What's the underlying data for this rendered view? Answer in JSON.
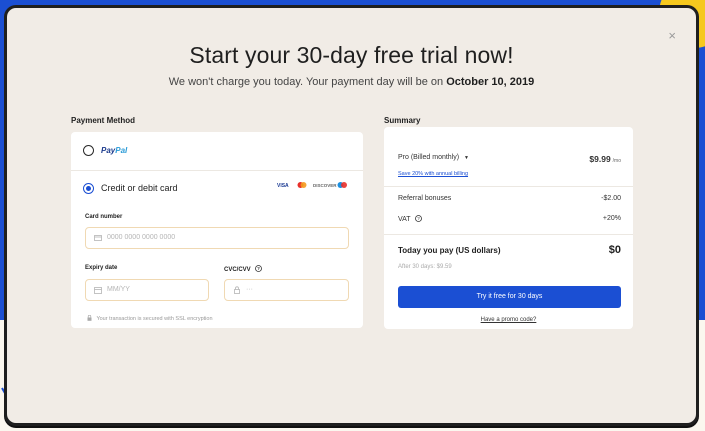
{
  "modal": {
    "close_glyph": "×",
    "title": "Start your 30-day free trial now!",
    "subtitle_prefix": "We won't charge you today. Your payment day will be on",
    "subtitle_date": "October 10, 2019"
  },
  "payment_method": {
    "section_label": "Payment Method",
    "options": {
      "paypal": {
        "label_a": "Pay",
        "label_b": "Pal",
        "selected": false
      },
      "card": {
        "label": "Credit or debit card",
        "selected": true
      }
    },
    "brands": [
      "VISA",
      "mastercard",
      "DISCOVER",
      "maestro"
    ],
    "card_number": {
      "label": "Card number",
      "placeholder": "0000 0000 0000 0000"
    },
    "expiry": {
      "label": "Expiry date",
      "placeholder": "MM/YY"
    },
    "cvc": {
      "label": "CVC/CVV",
      "placeholder": "···"
    },
    "secure_note": "Your transaction is secured with SSL encryption"
  },
  "summary": {
    "section_label": "Summary",
    "plan": {
      "label": "Pro (Billed monthly)",
      "price": "$9.99",
      "period": "/mo"
    },
    "annual_link": "Save 20% with annual billing",
    "referral": {
      "label": "Referral bonuses",
      "value": "-$2.00"
    },
    "vat": {
      "label": "VAT",
      "value": "+20%"
    },
    "today": {
      "label": "Today you pay (US dollars)",
      "value": "$0"
    },
    "after": "After 30 days: $9.59",
    "cta": "Try it free for 30 days",
    "promo": "Have a promo code?"
  },
  "colors": {
    "accent": "#1b4fd3",
    "background_yellow": "#f6c81e",
    "modal_bg": "#f1ece6"
  }
}
